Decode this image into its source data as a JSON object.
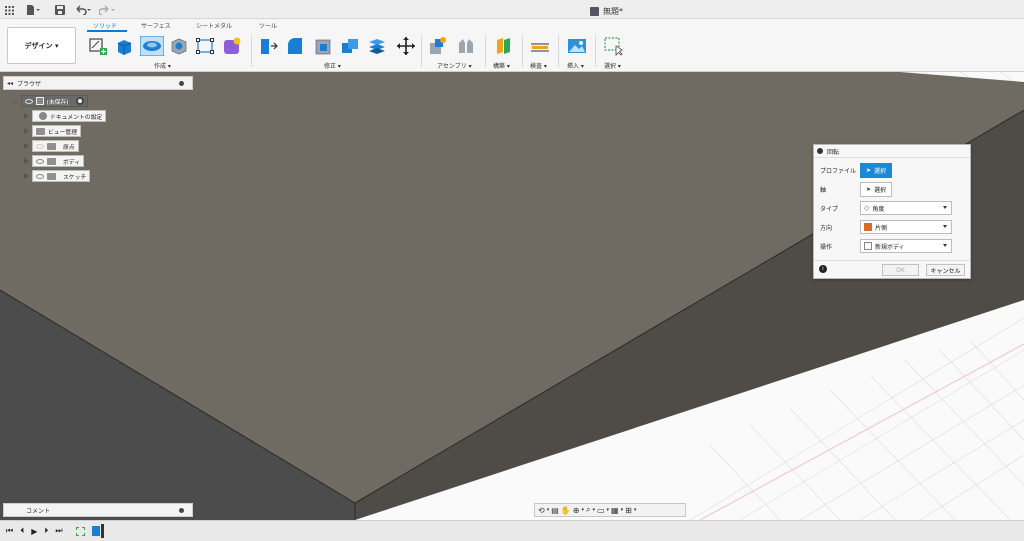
{
  "app": {
    "document_title": "無題*"
  },
  "ribbon": {
    "workspace_button": "デザイン ▾",
    "tabs": [
      {
        "label": "ソリッド",
        "active": true
      },
      {
        "label": "サーフェス",
        "active": false
      },
      {
        "label": "シートメタル",
        "active": false
      },
      {
        "label": "ツール",
        "active": false
      }
    ],
    "groups": {
      "create": "作成 ▾",
      "modify": "修正 ▾",
      "assemble": "アセンブリ ▾",
      "construct": "構築 ▾",
      "inspect": "検査 ▾",
      "insert": "挿入 ▾",
      "select": "選択 ▾"
    }
  },
  "browser": {
    "title": "ブラウザ",
    "root": "(未保存)",
    "items": [
      {
        "label": "ドキュメントの設定",
        "icon": "gear-icon"
      },
      {
        "label": "ビュー管理",
        "icon": "folder-icon"
      },
      {
        "label": "原点",
        "icon": "folder-icon"
      },
      {
        "label": "ボディ",
        "icon": "folder-icon"
      },
      {
        "label": "スケッチ",
        "icon": "folder-icon"
      }
    ]
  },
  "dialog": {
    "title": "回転",
    "profile_label": "プロファイル",
    "profile_button": "選択",
    "axis_label": "軸",
    "axis_button": "選択",
    "type_label": "タイプ",
    "type_value": "角度",
    "direction_label": "方向",
    "direction_value": "片側",
    "operation_label": "操作",
    "operation_value": "新規ボディ",
    "ok_label": "OK",
    "cancel_label": "キャンセル"
  },
  "comments": {
    "label": "コメント"
  },
  "colors": {
    "accent": "#0b7bd6",
    "body_top": "#6f6b63",
    "body_side": "#4f4c48"
  }
}
